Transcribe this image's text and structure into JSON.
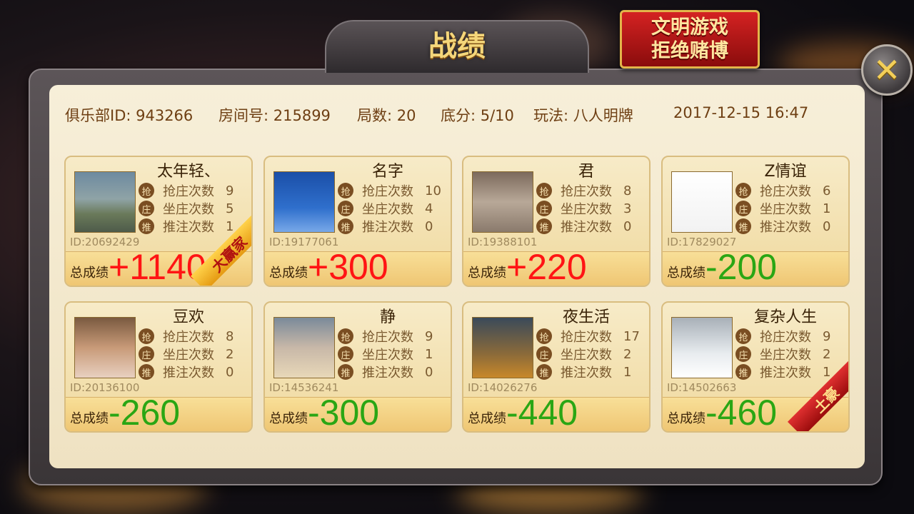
{
  "title": "战绩",
  "slogan": {
    "line1": "文明游戏",
    "line2": "拒绝赌博"
  },
  "close_label": "✕",
  "info": {
    "club": "俱乐部ID: 943266",
    "room": "房间号: 215899",
    "rounds": "局数: 20",
    "base": "底分: 5/10",
    "mode": "玩法: 八人明牌",
    "time": "2017-12-15 16:47"
  },
  "stat_labels": {
    "grab": "抢庄次数",
    "sit": "坐庄次数",
    "push": "推注次数"
  },
  "stat_badges": {
    "grab": "抢",
    "sit": "庄",
    "push": "推"
  },
  "total_label": "总成绩",
  "players": [
    {
      "name": "太年轻、",
      "id": "ID:20692429",
      "grab": "9",
      "sit": "5",
      "push": "1",
      "score": "+1140",
      "tag": "大赢家"
    },
    {
      "name": "名字",
      "id": "ID:19177061",
      "grab": "10",
      "sit": "4",
      "push": "0",
      "score": "+300",
      "tag": ""
    },
    {
      "name": "君",
      "id": "ID:19388101",
      "grab": "8",
      "sit": "3",
      "push": "0",
      "score": "+220",
      "tag": ""
    },
    {
      "name": "Z情谊",
      "id": "ID:17829027",
      "grab": "6",
      "sit": "1",
      "push": "0",
      "score": "-200",
      "tag": ""
    },
    {
      "name": "豆欢",
      "id": "ID:20136100",
      "grab": "8",
      "sit": "2",
      "push": "0",
      "score": "-260",
      "tag": ""
    },
    {
      "name": "静",
      "id": "ID:14536241",
      "grab": "9",
      "sit": "1",
      "push": "0",
      "score": "-300",
      "tag": ""
    },
    {
      "name": "夜生活",
      "id": "ID:14026276",
      "grab": "17",
      "sit": "2",
      "push": "1",
      "score": "-440",
      "tag": ""
    },
    {
      "name": "复杂人生",
      "id": "ID:14502663",
      "grab": "9",
      "sit": "2",
      "push": "1",
      "score": "-460",
      "tag": "土豪"
    }
  ]
}
